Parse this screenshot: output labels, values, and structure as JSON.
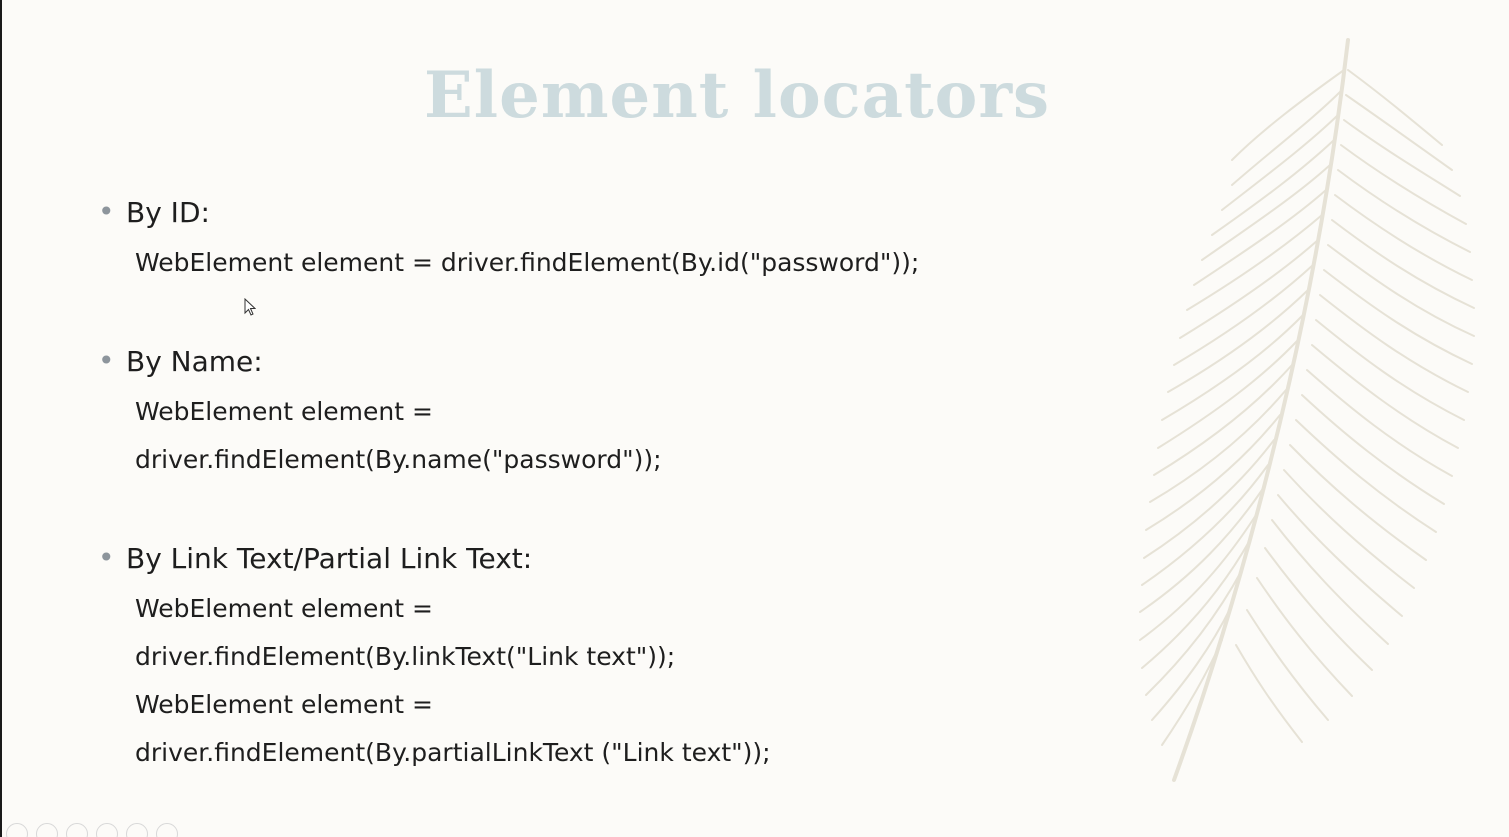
{
  "slide": {
    "title": "Element locators",
    "sections": [
      {
        "heading": "By ID:",
        "code_lines": [
          "WebElement element = driver.findElement(By.id(\"password\"));"
        ]
      },
      {
        "heading": "By Name:",
        "code_lines": [
          "WebElement element =",
          "driver.findElement(By.name(\"password\"));"
        ]
      },
      {
        "heading": "By Link Text/Partial Link Text:",
        "code_lines": [
          "WebElement element =",
          "driver.findElement(By.linkText(\"Link text\"));",
          "WebElement element =",
          "driver.findElement(By.partialLinkText (\"Link text\"));"
        ]
      }
    ]
  },
  "colors": {
    "title": "#cddbde",
    "text": "#1e1e1e",
    "bullet": "#8d959c",
    "background": "#fcfbf8",
    "feather": "#e6e2d6"
  },
  "icons": {
    "decoration": "feather-icon",
    "pointer": "mouse-cursor-icon",
    "controls": [
      "previous-icon",
      "next-icon",
      "pen-icon",
      "slides-grid-icon",
      "zoom-icon",
      "more-icon"
    ]
  }
}
